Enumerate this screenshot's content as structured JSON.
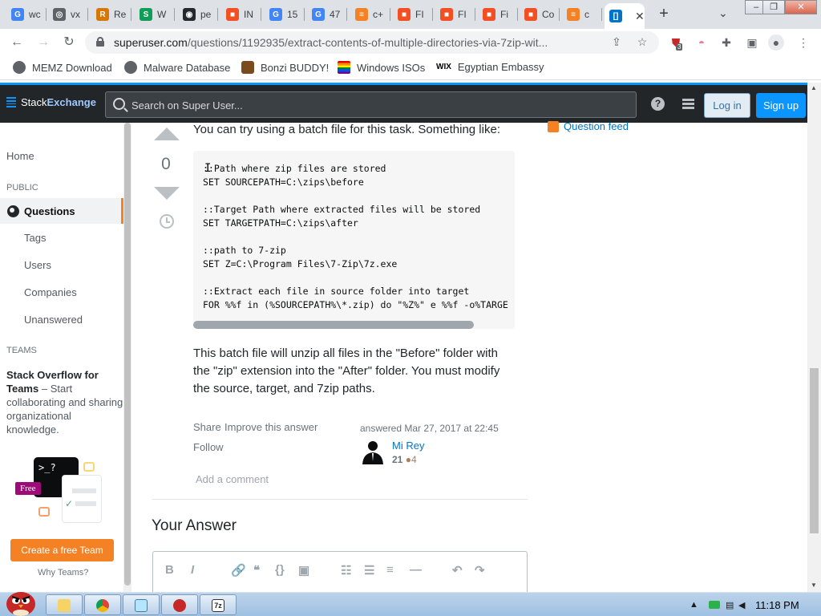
{
  "browser": {
    "tabs": [
      {
        "label": "wc",
        "color": "#4285f4",
        "glyph": "G"
      },
      {
        "label": "vx",
        "color": "#5f6368",
        "glyph": "◎"
      },
      {
        "label": "Re",
        "color": "#d97706",
        "glyph": "R"
      },
      {
        "label": "W",
        "color": "#0f9d58",
        "glyph": "S"
      },
      {
        "label": "pe",
        "color": "#24292f",
        "glyph": "◉"
      },
      {
        "label": "IN",
        "color": "#f25022",
        "glyph": "■"
      },
      {
        "label": "15",
        "color": "#4285f4",
        "glyph": "G"
      },
      {
        "label": "47",
        "color": "#4285f4",
        "glyph": "G"
      },
      {
        "label": "c+",
        "color": "#f48225",
        "glyph": "≡"
      },
      {
        "label": "FI",
        "color": "#f25022",
        "glyph": "■"
      },
      {
        "label": "FI",
        "color": "#f25022",
        "glyph": "■"
      },
      {
        "label": "Fi",
        "color": "#f25022",
        "glyph": "■"
      },
      {
        "label": "Co",
        "color": "#f25022",
        "glyph": "■"
      },
      {
        "label": "c",
        "color": "#f48225",
        "glyph": "≡"
      },
      {
        "label": "",
        "color": "#0074cc",
        "glyph": "[]",
        "active": true
      }
    ],
    "url_host": "superuser.com",
    "url_path": "/questions/1192935/extract-contents-of-multiple-directories-via-7zip-wit...",
    "extension_badge": "3"
  },
  "bookmarks": [
    {
      "label": "MEMZ Download"
    },
    {
      "label": "Malware Database"
    },
    {
      "label": "Bonzi BUDDY!"
    },
    {
      "label": "Windows ISOs"
    },
    {
      "label": "Egyptian Embassy"
    }
  ],
  "topbar": {
    "logo_a": "Stack",
    "logo_b": "Exchange",
    "search_placeholder": "Search on Super User...",
    "login": "Log in",
    "signup": "Sign up"
  },
  "leftnav": {
    "home": "Home",
    "public": "PUBLIC",
    "questions": "Questions",
    "items": [
      "Tags",
      "Users",
      "Companies",
      "Unanswered"
    ],
    "teams_heading": "TEAMS",
    "teams_title": "Stack Overflow for Teams",
    "teams_text": " – Start collaborating and sharing organizational knowledge.",
    "free_badge": "Free",
    "create_team": "Create a free Team",
    "why_teams": "Why Teams?"
  },
  "answer": {
    "vote_count": "0",
    "intro": "You can try using a batch file for this task. Something like:",
    "code": "::Path where zip files are stored\nSET SOURCEPATH=C:\\zips\\before\n\n::Target Path where extracted files will be stored\nSET TARGETPATH=C:\\zips\\after\n\n::path to 7-zip\nSET Z=C:\\Program Files\\7-Zip\\7z.exe\n\n::Extract each file in source folder into target\nFOR %%f in (%SOURCEPATH%\\*.zip) do \"%Z%\" e %%f -o%TARGE",
    "body": "This batch file will unzip all files in the \"Before\" folder with the \"zip\" extension into the \"After\" folder. You must modify the source, target, and 7zip paths.",
    "share": "Share",
    "improve": "Improve this answer",
    "follow": "Follow",
    "answered": "answered Mar 27, 2017 at 22:45",
    "user_name": "Mi Rey",
    "user_rep": "21",
    "user_bronze": "●4",
    "add_comment": "Add a comment"
  },
  "sidebar_right": {
    "question_feed": "Question feed"
  },
  "your_answer": "Your Answer",
  "editor_buttons": [
    "B",
    "I",
    "🔗",
    "❝",
    "{}",
    "▣",
    "☷",
    "☰",
    "≡",
    "—",
    "↶",
    "↷"
  ],
  "taskbar": {
    "clock": "11:18 PM"
  }
}
